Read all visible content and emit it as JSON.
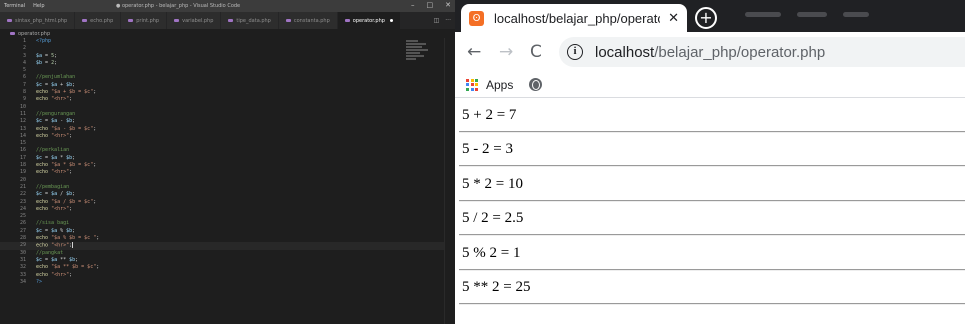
{
  "vscode": {
    "menu": [
      "Terminal",
      "Help"
    ],
    "window_title": "● operator.php - belajar_php - Visual Studio Code",
    "window_controls": [
      "–",
      "□",
      "✕"
    ],
    "tabs": [
      {
        "label": "sintax_php_html.php",
        "active": false
      },
      {
        "label": "echo.php",
        "active": false
      },
      {
        "label": "print.php",
        "active": false
      },
      {
        "label": "variabel.php",
        "active": false
      },
      {
        "label": "tipe_data.php",
        "active": false
      },
      {
        "label": "constanta.php",
        "active": false
      },
      {
        "label": "operator.php",
        "active": true
      }
    ],
    "tab_actions": [
      "◫",
      "···"
    ],
    "breadcrumb": "operator.php",
    "code_lines": [
      [
        [
          "kw",
          "<?php"
        ]
      ],
      [],
      [
        [
          "var",
          "$a"
        ],
        [
          "op",
          " = "
        ],
        [
          "num",
          "5"
        ],
        [
          "op",
          ";"
        ]
      ],
      [
        [
          "var",
          "$b"
        ],
        [
          "op",
          " = "
        ],
        [
          "num",
          "2"
        ],
        [
          "op",
          ";"
        ]
      ],
      [],
      [
        [
          "com",
          "//penjumlahan"
        ]
      ],
      [
        [
          "var",
          "$c"
        ],
        [
          "op",
          " = "
        ],
        [
          "var",
          "$a"
        ],
        [
          "op",
          " + "
        ],
        [
          "var",
          "$b"
        ],
        [
          "op",
          ";"
        ]
      ],
      [
        [
          "fn",
          "echo"
        ],
        [
          "op",
          " "
        ],
        [
          "str",
          "\"$a + $b = $c\""
        ],
        [
          "op",
          ";"
        ]
      ],
      [
        [
          "fn",
          "echo"
        ],
        [
          "op",
          " "
        ],
        [
          "str",
          "\"<hr>\""
        ],
        [
          "op",
          ";"
        ]
      ],
      [],
      [
        [
          "com",
          "//pengurangan"
        ]
      ],
      [
        [
          "var",
          "$c"
        ],
        [
          "op",
          " = "
        ],
        [
          "var",
          "$a"
        ],
        [
          "op",
          " - "
        ],
        [
          "var",
          "$b"
        ],
        [
          "op",
          ";"
        ]
      ],
      [
        [
          "fn",
          "echo"
        ],
        [
          "op",
          " "
        ],
        [
          "str",
          "\"$a - $b = $c\""
        ],
        [
          "op",
          ";"
        ]
      ],
      [
        [
          "fn",
          "echo"
        ],
        [
          "op",
          " "
        ],
        [
          "str",
          "\"<hr>\""
        ],
        [
          "op",
          ";"
        ]
      ],
      [],
      [
        [
          "com",
          "//perkalian"
        ]
      ],
      [
        [
          "var",
          "$c"
        ],
        [
          "op",
          " = "
        ],
        [
          "var",
          "$a"
        ],
        [
          "op",
          " * "
        ],
        [
          "var",
          "$b"
        ],
        [
          "op",
          ";"
        ]
      ],
      [
        [
          "fn",
          "echo"
        ],
        [
          "op",
          " "
        ],
        [
          "str",
          "\"$a * $b = $c\""
        ],
        [
          "op",
          ";"
        ]
      ],
      [
        [
          "fn",
          "echo"
        ],
        [
          "op",
          " "
        ],
        [
          "str",
          "\"<hr>\""
        ],
        [
          "op",
          ";"
        ]
      ],
      [],
      [
        [
          "com",
          "//pembagian"
        ]
      ],
      [
        [
          "var",
          "$c"
        ],
        [
          "op",
          " = "
        ],
        [
          "var",
          "$a"
        ],
        [
          "op",
          " / "
        ],
        [
          "var",
          "$b"
        ],
        [
          "op",
          ";"
        ]
      ],
      [
        [
          "fn",
          "echo"
        ],
        [
          "op",
          " "
        ],
        [
          "str",
          "\"$a / $b = $c\""
        ],
        [
          "op",
          ";"
        ]
      ],
      [
        [
          "fn",
          "echo"
        ],
        [
          "op",
          " "
        ],
        [
          "str",
          "\"<hr>\""
        ],
        [
          "op",
          ";"
        ]
      ],
      [],
      [
        [
          "com",
          "//sisa bagi"
        ]
      ],
      [
        [
          "var",
          "$c"
        ],
        [
          "op",
          " = "
        ],
        [
          "var",
          "$a"
        ],
        [
          "op",
          " % "
        ],
        [
          "var",
          "$b"
        ],
        [
          "op",
          ";"
        ]
      ],
      [
        [
          "fn",
          "echo"
        ],
        [
          "op",
          " "
        ],
        [
          "str",
          "\"$a % $b = $c \""
        ],
        [
          "op",
          ";"
        ]
      ],
      [
        [
          "fn",
          "echo"
        ],
        [
          "op",
          " "
        ],
        [
          "str",
          "\"<hr>\""
        ],
        [
          "op",
          ";"
        ]
      ],
      [
        [
          "com",
          "//pangkat"
        ]
      ],
      [
        [
          "var",
          "$c"
        ],
        [
          "op",
          " = "
        ],
        [
          "var",
          "$a"
        ],
        [
          "op",
          " ** "
        ],
        [
          "var",
          "$b"
        ],
        [
          "op",
          ";"
        ]
      ],
      [
        [
          "fn",
          "echo"
        ],
        [
          "op",
          " "
        ],
        [
          "str",
          "\"$a ** $b = $c\""
        ],
        [
          "op",
          ";"
        ]
      ],
      [
        [
          "fn",
          "echo"
        ],
        [
          "op",
          " "
        ],
        [
          "str",
          "\"<hr>\""
        ],
        [
          "op",
          ";"
        ]
      ],
      [
        [
          "kw",
          "?>"
        ]
      ]
    ],
    "cursor_line": 29
  },
  "browser": {
    "tab_title": "localhost/belajar_php/operator.p",
    "tab_close": "✕",
    "new_tab": "+",
    "nav": {
      "back": "←",
      "forward": "→",
      "reload": "C"
    },
    "url_host": "localhost",
    "url_path": "/belajar_php/operator.php",
    "info_icon": "i",
    "bookmarks": {
      "apps_label": "Apps"
    },
    "apps_icon_colors": [
      "#ea4335",
      "#fbbc04",
      "#34a853",
      "#4285f4",
      "#ea4335",
      "#fbbc04",
      "#34a853",
      "#4285f4",
      "#ea4335"
    ],
    "results": [
      "5 + 2 = 7",
      "5 - 2 = 3",
      "5 * 2 = 10",
      "5 / 2 = 2.5",
      "5 % 2 = 1",
      "5 ** 2 = 25"
    ]
  },
  "colors": {
    "vscode_bg": "#1e1e1e",
    "tabstrip_bg": "#202124",
    "favicon": "#f46f25"
  }
}
